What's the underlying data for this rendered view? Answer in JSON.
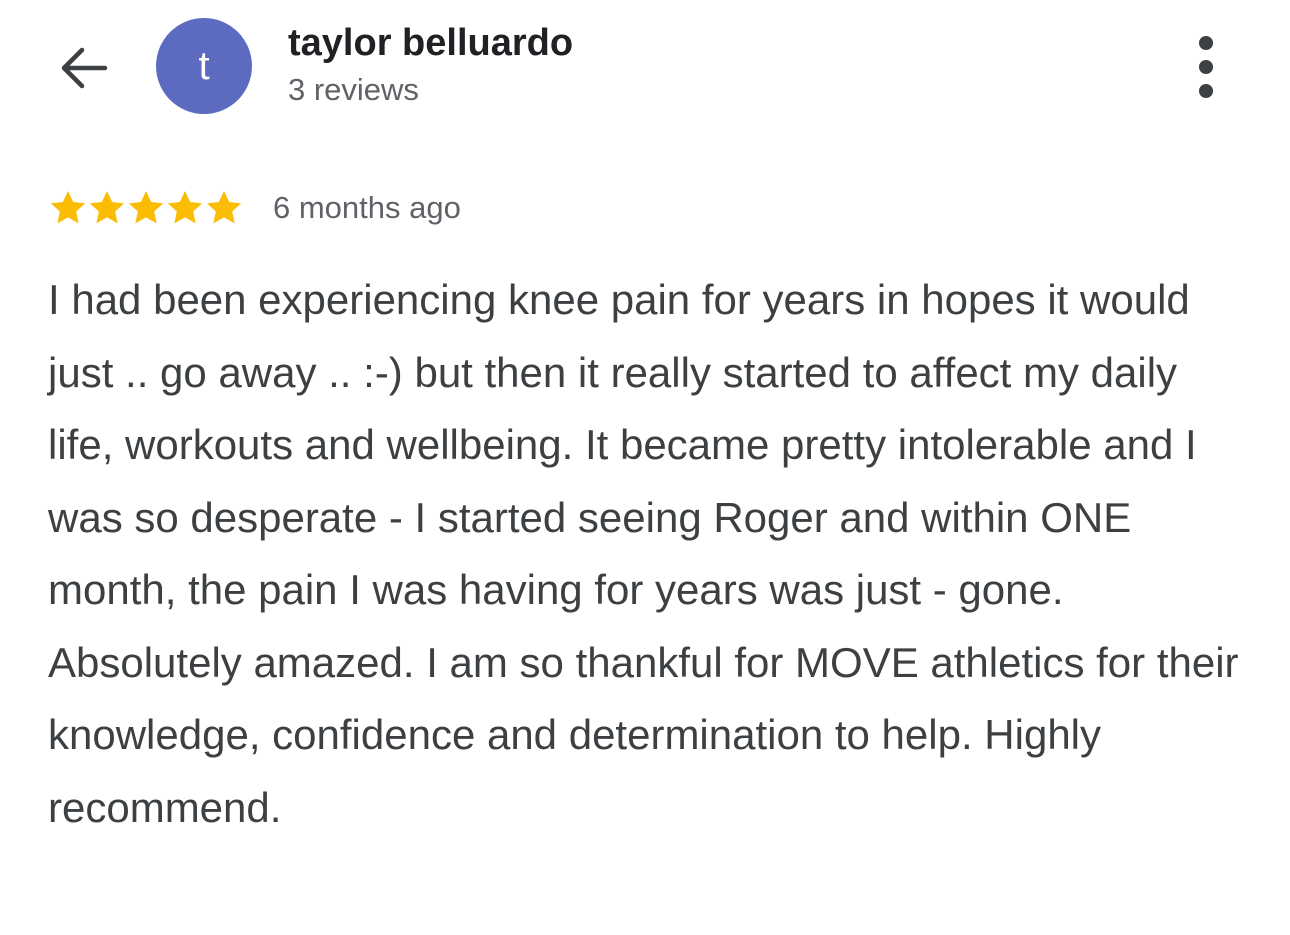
{
  "header": {
    "back_icon": "arrow-left-icon",
    "avatar_letter": "t",
    "avatar_color": "#5c6bc0",
    "reviewer_name": "taylor belluardo",
    "review_count": "3 reviews",
    "more_icon": "more-vert-icon"
  },
  "review": {
    "rating": 5,
    "rating_max": 5,
    "star_color": "#fbbc04",
    "date": "6 months ago",
    "text": "I had been experiencing knee pain for years in hopes it would just .. go away .. :-) but then it really started to affect my daily life, workouts and wellbeing. It became pretty intolerable and I was so desperate - I started seeing Roger and within ONE month, the pain I was having for years was just - gone. Absolutely amazed. I am so thankful for MOVE athletics for their knowledge, confidence and determination to help. Highly recommend."
  }
}
